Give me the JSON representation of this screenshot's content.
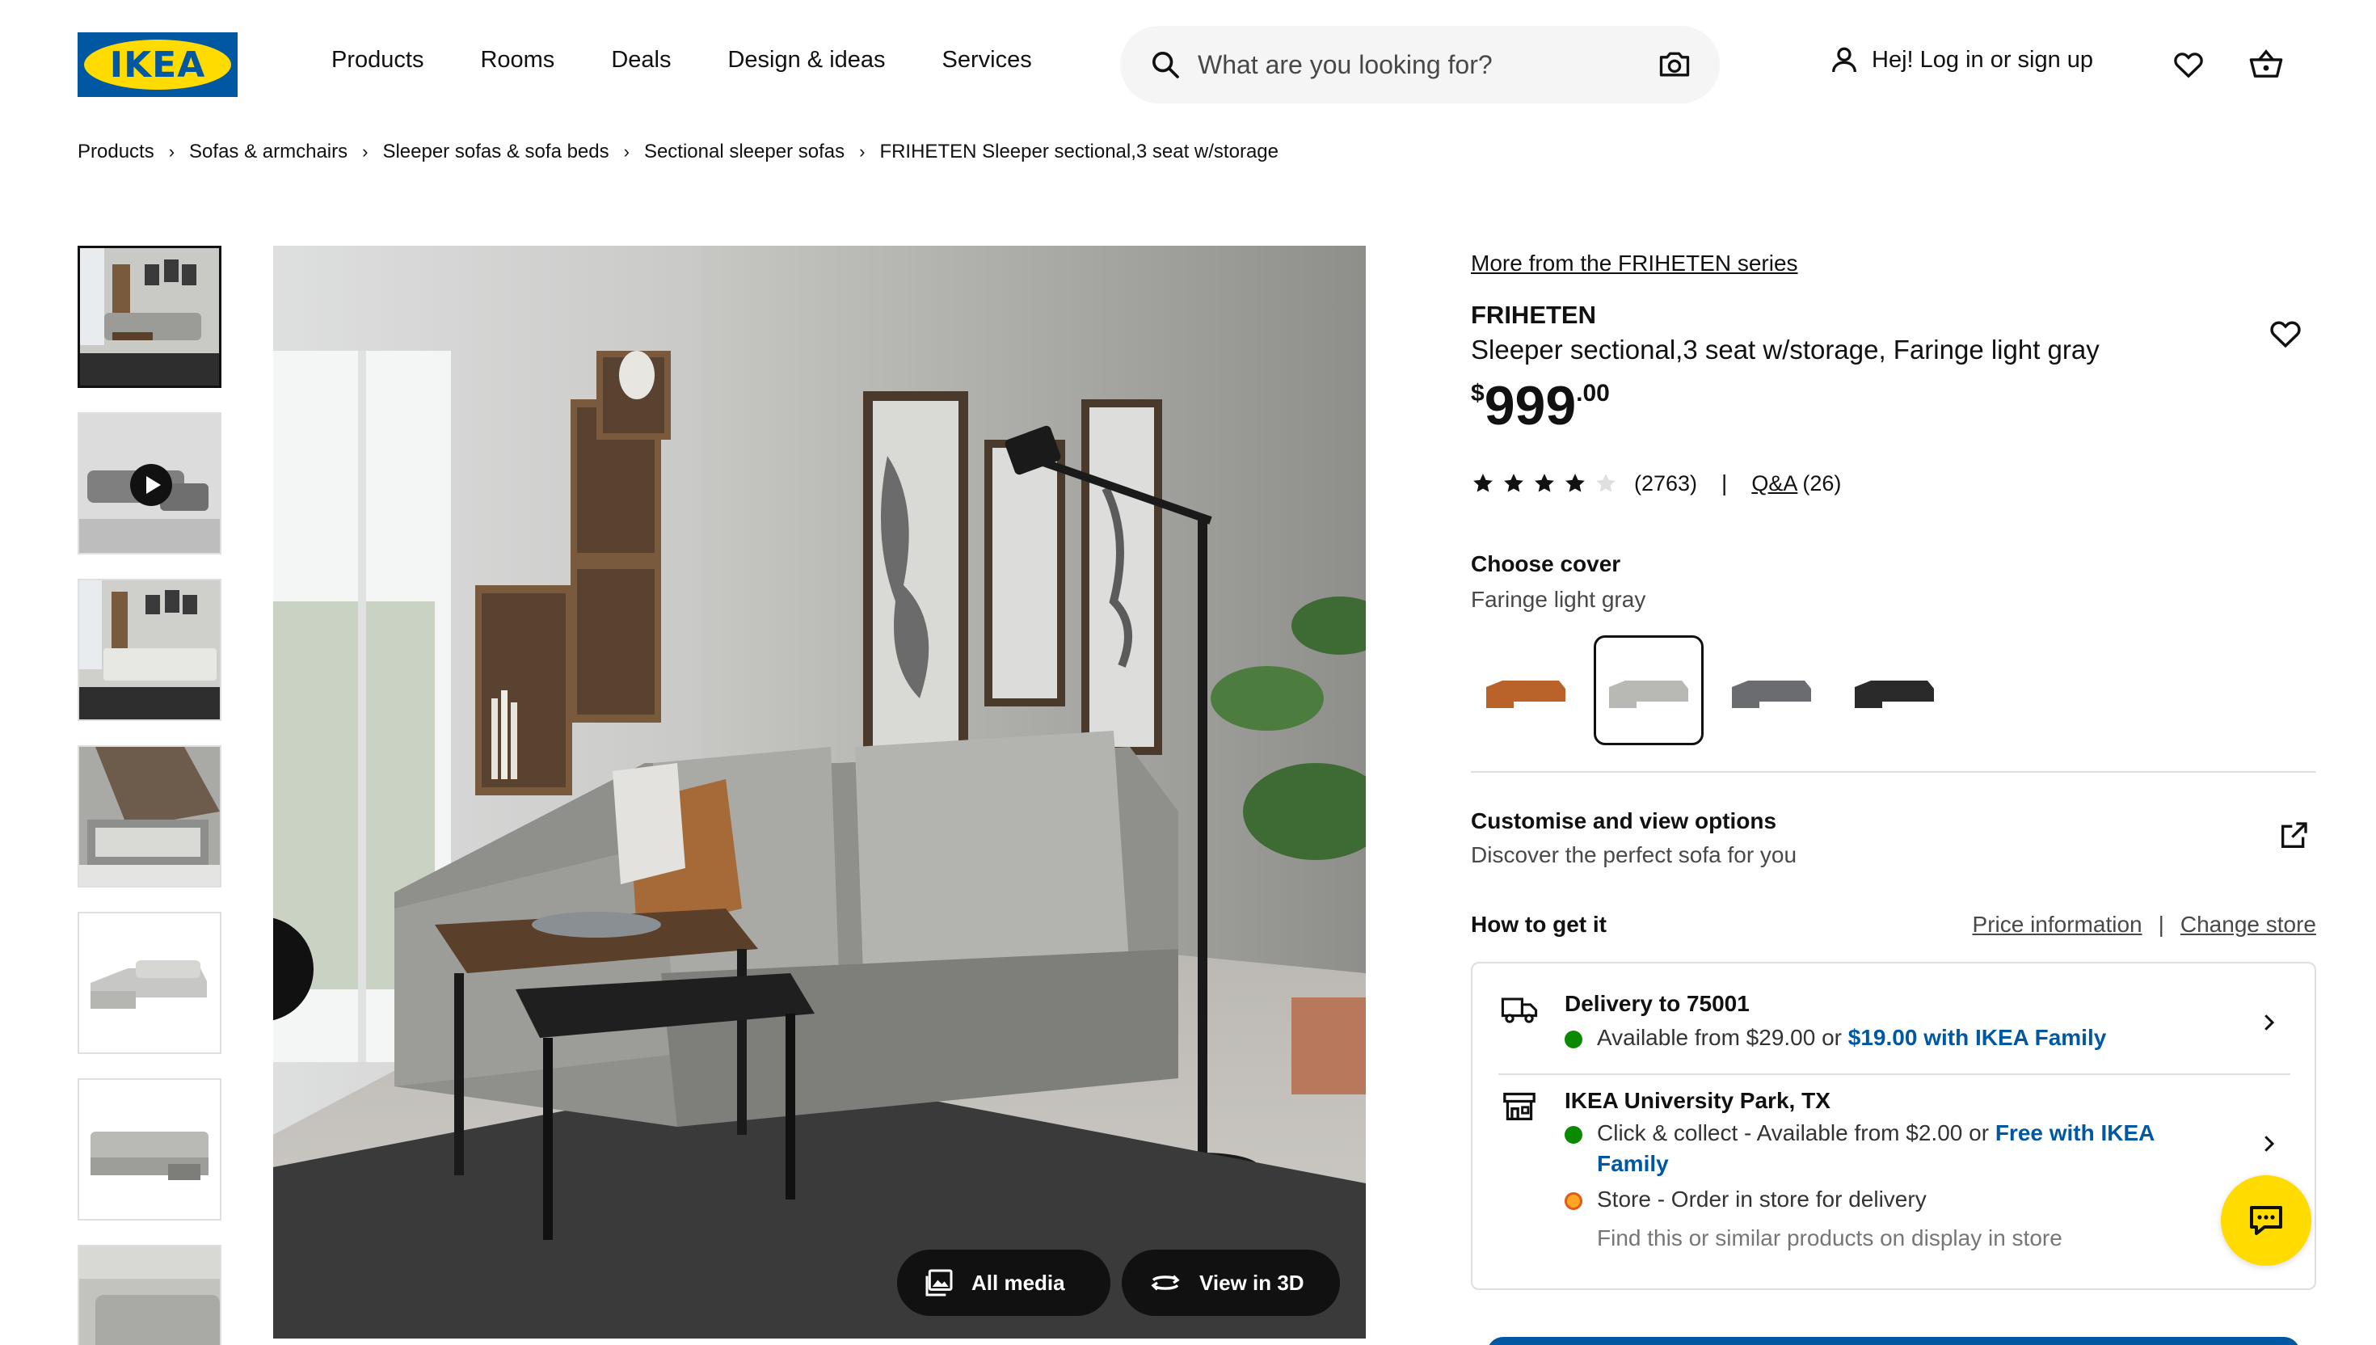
{
  "header": {
    "logo_text": "IKEA",
    "nav": [
      "Products",
      "Rooms",
      "Deals",
      "Design & ideas",
      "Services"
    ],
    "search_placeholder": "What are you looking for?",
    "login_label": "Hej! Log in or sign up"
  },
  "breadcrumb": [
    "Products",
    "Sofas & armchairs",
    "Sleeper sofas & sofa beds",
    "Sectional sleeper sofas",
    "FRIHETEN Sleeper sectional,3 seat w/storage"
  ],
  "gallery": {
    "all_media_label": "All media",
    "view_3d_label": "View in 3D"
  },
  "product": {
    "series_link": "More from the FRIHETEN series",
    "name": "FRIHETEN",
    "description": "Sleeper sectional,3 seat w/storage, Faringe light gray",
    "price_currency": "$",
    "price_integer": "999",
    "price_decimal": ".00",
    "rating_value": 4,
    "rating_max": 5,
    "rating_count": "(2763)",
    "qa_label": "Q&A",
    "qa_count": "(26)"
  },
  "cover": {
    "title": "Choose cover",
    "selected": "Faringe light gray",
    "swatch_colors": [
      "#b9632a",
      "#b8b8b4",
      "#6a6c6f",
      "#2a2a2a"
    ],
    "selected_index": 1
  },
  "customise": {
    "title": "Customise and view options",
    "subtitle": "Discover the perfect sofa for you"
  },
  "how_to_get": {
    "title": "How to get it",
    "price_info_link": "Price information",
    "change_store_link": "Change store",
    "delivery": {
      "title": "Delivery to 75001",
      "line_prefix": "Available from $29.00 or",
      "line_highlight": "$19.00 with IKEA Family"
    },
    "store": {
      "title": "IKEA University Park, TX",
      "collect_prefix": "Click & collect - Available from $2.00 or",
      "collect_highlight_1": "Free with IKEA",
      "collect_highlight_2": "Family",
      "store_line": "Store - Order in store for delivery",
      "find_line": "Find this or similar products on display in store"
    }
  },
  "colors": {
    "ikea_blue": "#0058a3",
    "ikea_yellow": "#ffdb00",
    "available_green": "#0a8a00",
    "store_orange": "#ffa524"
  }
}
